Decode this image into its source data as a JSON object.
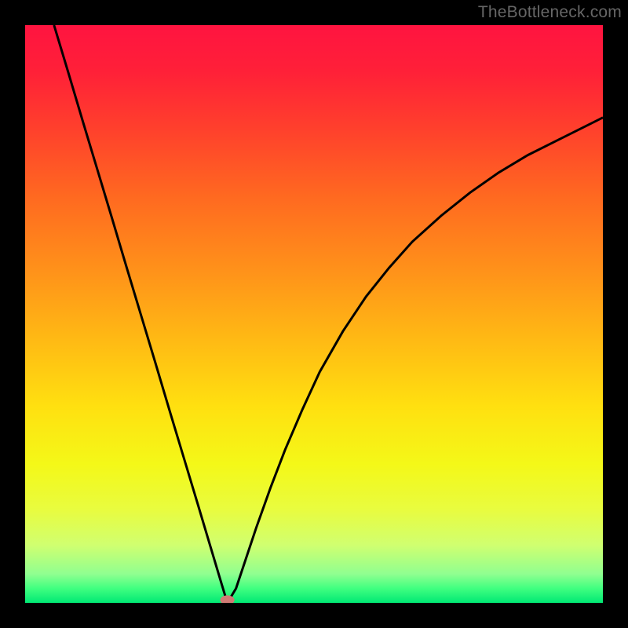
{
  "source_label": "TheBottleneck.com",
  "chart_data": {
    "type": "line",
    "title": "",
    "xlabel": "",
    "ylabel": "",
    "xlim": [
      0,
      100
    ],
    "ylim": [
      0,
      100
    ],
    "curve": {
      "name": "bottleneck-curve",
      "points": [
        {
          "x": 5.0,
          "y": 100.0
        },
        {
          "x": 7.5,
          "y": 91.7
        },
        {
          "x": 10.0,
          "y": 83.3
        },
        {
          "x": 12.5,
          "y": 75.0
        },
        {
          "x": 15.0,
          "y": 66.7
        },
        {
          "x": 17.5,
          "y": 58.3
        },
        {
          "x": 20.0,
          "y": 50.0
        },
        {
          "x": 22.5,
          "y": 41.7
        },
        {
          "x": 25.0,
          "y": 33.3
        },
        {
          "x": 27.5,
          "y": 25.0
        },
        {
          "x": 30.0,
          "y": 16.7
        },
        {
          "x": 32.0,
          "y": 10.0
        },
        {
          "x": 34.0,
          "y": 3.3
        },
        {
          "x": 35.0,
          "y": 0.0
        },
        {
          "x": 36.5,
          "y": 2.5
        },
        {
          "x": 38.0,
          "y": 7.0
        },
        {
          "x": 40.0,
          "y": 13.0
        },
        {
          "x": 42.5,
          "y": 20.0
        },
        {
          "x": 45.0,
          "y": 26.5
        },
        {
          "x": 48.0,
          "y": 33.5
        },
        {
          "x": 51.0,
          "y": 40.0
        },
        {
          "x": 55.0,
          "y": 47.0
        },
        {
          "x": 59.0,
          "y": 53.0
        },
        {
          "x": 63.0,
          "y": 58.0
        },
        {
          "x": 67.0,
          "y": 62.5
        },
        {
          "x": 72.0,
          "y": 67.0
        },
        {
          "x": 77.0,
          "y": 71.0
        },
        {
          "x": 82.0,
          "y": 74.5
        },
        {
          "x": 87.0,
          "y": 77.5
        },
        {
          "x": 92.0,
          "y": 80.0
        },
        {
          "x": 97.0,
          "y": 82.5
        },
        {
          "x": 100.0,
          "y": 84.0
        }
      ]
    },
    "marker": {
      "x": 35,
      "y": 0,
      "rx": 9,
      "ry": 6,
      "color": "#d07a74"
    },
    "gradient_stops": [
      {
        "offset": 0.0,
        "color": "#ff1440"
      },
      {
        "offset": 0.08,
        "color": "#ff2038"
      },
      {
        "offset": 0.18,
        "color": "#ff402c"
      },
      {
        "offset": 0.3,
        "color": "#ff6a20"
      },
      {
        "offset": 0.42,
        "color": "#ff901a"
      },
      {
        "offset": 0.54,
        "color": "#ffb814"
      },
      {
        "offset": 0.66,
        "color": "#ffe010"
      },
      {
        "offset": 0.76,
        "color": "#f4f818"
      },
      {
        "offset": 0.84,
        "color": "#e8fc40"
      },
      {
        "offset": 0.9,
        "color": "#d0ff70"
      },
      {
        "offset": 0.95,
        "color": "#90ff90"
      },
      {
        "offset": 0.975,
        "color": "#40ff80"
      },
      {
        "offset": 1.0,
        "color": "#00e874"
      }
    ]
  }
}
